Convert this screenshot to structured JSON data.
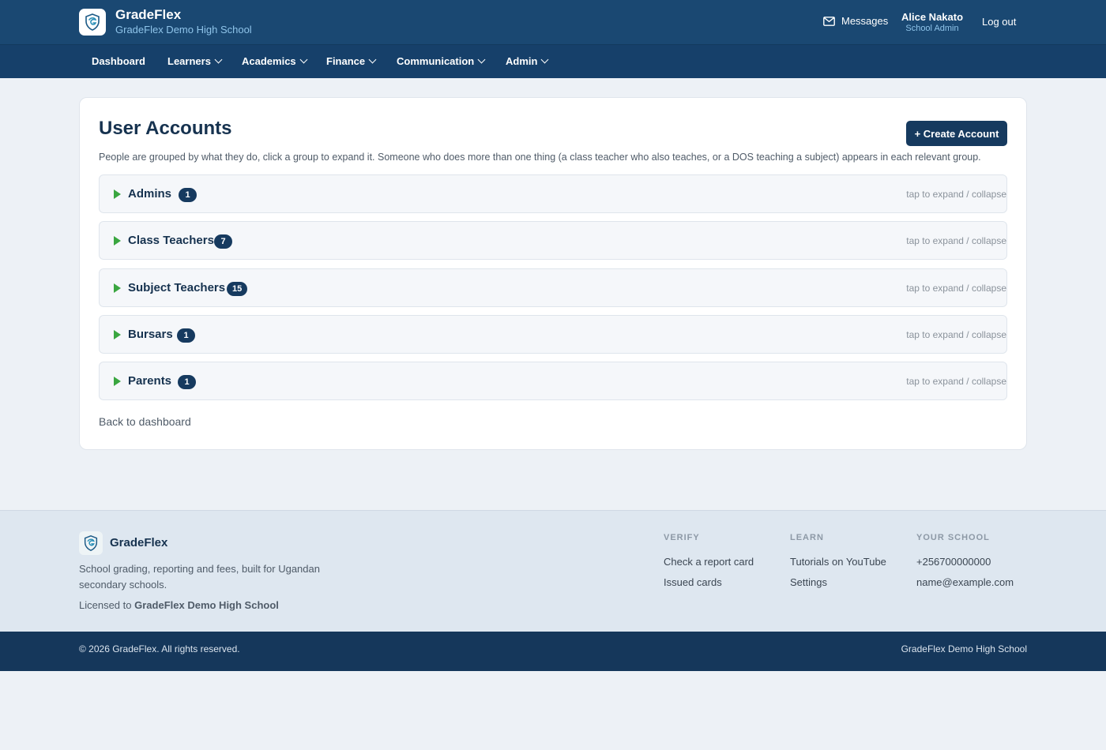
{
  "brand": {
    "name": "GradeFlex",
    "school": "GradeFlex Demo High School",
    "logo_icon": "shield-crest-icon"
  },
  "header": {
    "messages_label": "Messages",
    "user_name": "Alice Nakato",
    "user_role": "School Admin",
    "logout_label": "Log out"
  },
  "nav": {
    "items": [
      {
        "label": "Dashboard",
        "dropdown": false
      },
      {
        "label": "Learners",
        "dropdown": true
      },
      {
        "label": "Academics",
        "dropdown": true
      },
      {
        "label": "Finance",
        "dropdown": true
      },
      {
        "label": "Communication",
        "dropdown": true
      },
      {
        "label": "Admin",
        "dropdown": true
      }
    ]
  },
  "page": {
    "title": "User Accounts",
    "create_button": "+ Create Account",
    "intro": "People are grouped by what they do, click a group to expand it. Someone who does more than one thing (a class teacher who also teaches, or a DOS teaching a subject) appears in each relevant group.",
    "groups": [
      {
        "label": "Admins",
        "count": "1",
        "hint": "tap to expand / collapse"
      },
      {
        "label": "Class Teachers",
        "count": "7",
        "hint": "tap to expand / collapse"
      },
      {
        "label": "Subject Teachers",
        "count": "15",
        "hint": "tap to expand / collapse"
      },
      {
        "label": "Bursars",
        "count": "1",
        "hint": "tap to expand / collapse"
      },
      {
        "label": "Parents",
        "count": "1",
        "hint": "tap to expand / collapse"
      }
    ],
    "back_link": "Back to dashboard"
  },
  "footer": {
    "brand": "GradeFlex",
    "tagline": "School grading, reporting and fees, built for Ugandan secondary schools.",
    "license_prefix": "Licensed to",
    "license_school": "GradeFlex Demo High School",
    "columns": [
      {
        "heading": "VERIFY",
        "links": [
          "Check a report card",
          "Issued cards"
        ]
      },
      {
        "heading": "LEARN",
        "links": [
          "Tutorials on YouTube",
          "Settings"
        ]
      },
      {
        "heading": "YOUR SCHOOL",
        "links": [
          "+256700000000",
          "name@example.com"
        ]
      }
    ],
    "copyright": "© 2026 GradeFlex. All rights reserved.",
    "school": "GradeFlex Demo High School"
  },
  "colors": {
    "header": "#1a4872",
    "nav": "#16406a",
    "primary": "#163a5f",
    "accent_green": "#3aa640",
    "link_blue": "#8fc4ea"
  }
}
